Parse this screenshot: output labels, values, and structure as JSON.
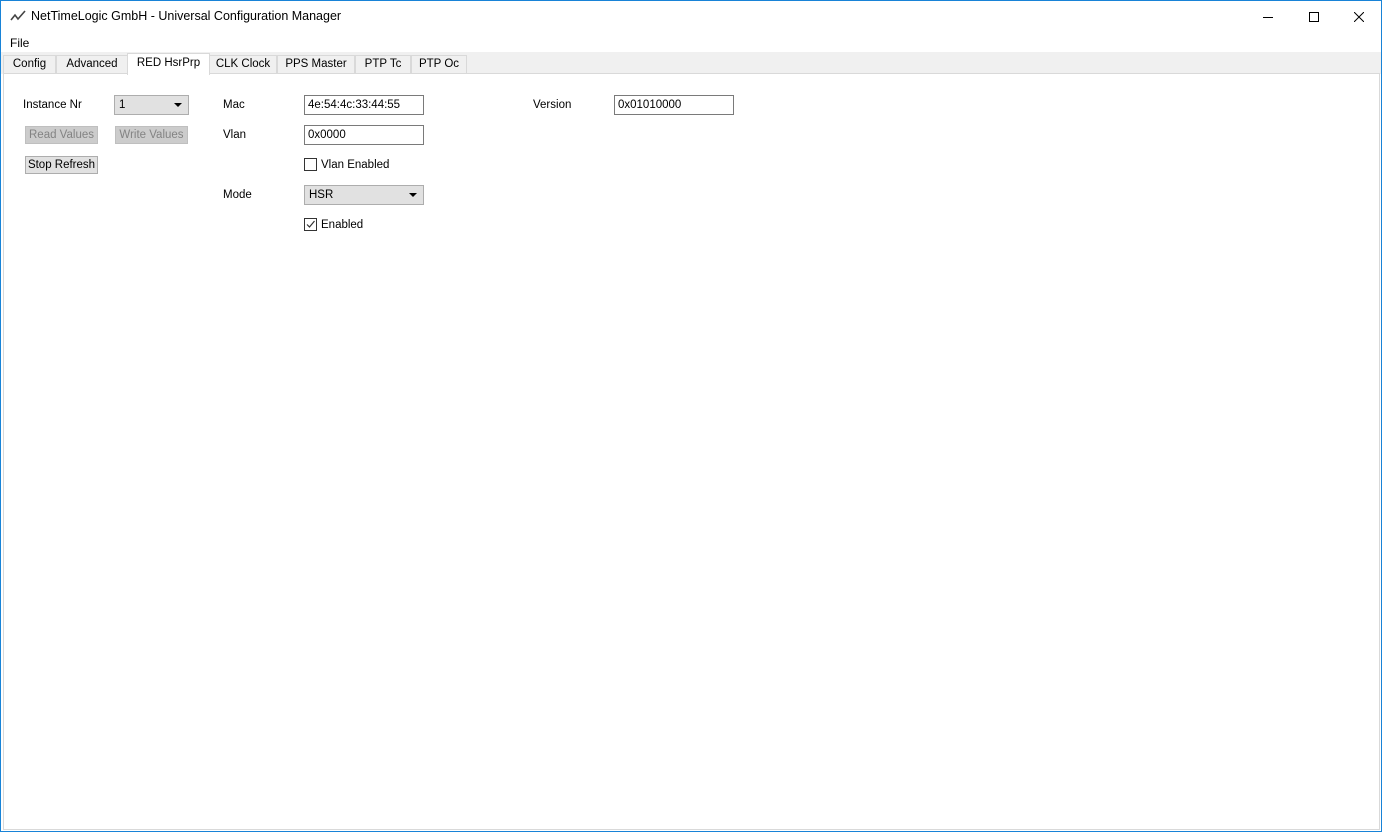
{
  "window": {
    "title": "NetTimeLogic GmbH - Universal Configuration Manager"
  },
  "menu": {
    "file": "File"
  },
  "tabs": [
    {
      "label": "Config"
    },
    {
      "label": "Advanced"
    },
    {
      "label": "RED HsrPrp",
      "selected": true
    },
    {
      "label": "CLK Clock"
    },
    {
      "label": "PPS Master"
    },
    {
      "label": "PTP Tc"
    },
    {
      "label": "PTP Oc"
    }
  ],
  "form": {
    "instance_label": "Instance Nr",
    "instance_value": "1",
    "read_values": "Read Values",
    "write_values": "Write Values",
    "stop_refresh": "Stop Refresh",
    "mac_label": "Mac",
    "mac_value": "4e:54:4c:33:44:55",
    "vlan_label": "Vlan",
    "vlan_value": "0x0000",
    "vlan_enabled_label": "Vlan Enabled",
    "vlan_enabled": false,
    "mode_label": "Mode",
    "mode_value": "HSR",
    "enabled_label": "Enabled",
    "enabled": true,
    "version_label": "Version",
    "version_value": "0x01010000"
  }
}
